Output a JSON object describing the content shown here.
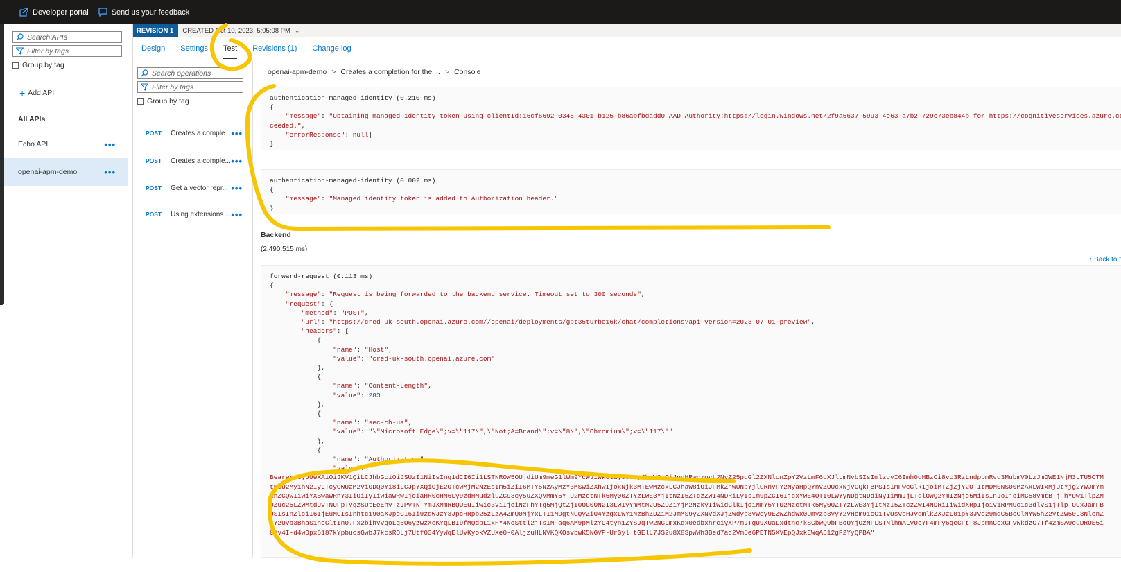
{
  "topbar": {
    "developer_portal": "Developer portal",
    "feedback": "Send us your feedback"
  },
  "api_pane": {
    "search_placeholder": "Search APIs",
    "filter_placeholder": "Filter by tags",
    "group_by_tag": "Group by tag",
    "add_api": "Add API",
    "all_apis": "All APIs",
    "apis": [
      {
        "name": "Echo API"
      },
      {
        "name": "openai-apm-demo"
      }
    ]
  },
  "revision": {
    "badge": "REVISION 1",
    "created": "CREATED Oct 10, 2023, 5:05:08 PM"
  },
  "tabs": [
    "Design",
    "Settings",
    "Test",
    "Revisions (1)",
    "Change log"
  ],
  "ops_pane": {
    "search_placeholder": "Search operations",
    "filter_placeholder": "Filter by tags",
    "group_by_tag": "Group by tag",
    "method": "POST",
    "operations": [
      "Creates a comple...",
      "Creates a comple...",
      "Get a vector repr...",
      "Using extensions ..."
    ]
  },
  "breadcrumb": [
    "openai-apm-demo",
    "Creates a completion for the ...",
    "Console"
  ],
  "console": {
    "trace1_header": "authentication-managed-identity (0.210 ms)",
    "trace1_message_line1": "Obtaining managed identity token using clientId:16cf6692-0345-4301-b125-b86abfbdadd0 AAD Authority:https://login.windows.net/2f9a5637-5993-4e63-a7b2-729e73eb844b for https://cognitiveservices.azure.com audience suc",
    "trace1_message_line2": "ceeded.",
    "trace1_error": "null",
    "trace2_header": "authentication-managed-identity (0.002 ms)",
    "trace2_message": "Managed identity token is added to Authorization header.",
    "backend_label": "Backend",
    "backend_time": "(2,490.515 ms)",
    "back_to_top": "↑ Back to t",
    "forward_header": "forward-request (0.113 ms)",
    "forward_message": "Request is being forwarded to the backend service. Timeout set to 300 seconds",
    "method": "POST",
    "url": "https://cred-uk-south.openai.azure.com//openai/deployments/gpt35turbo16k/chat/completions?api-version=2023-07-01-preview",
    "headers": [
      {
        "name": "Host",
        "value": "cred-uk-south.openai.azure.com"
      },
      {
        "name": "Content-Length",
        "value": "283"
      },
      {
        "name": "sec-ch-ua",
        "value": "\\\"Microsoft Edge\\\";v=\\\"117\\\",\\\"Not;A=Brand\\\";v=\\\"8\\\",\\\"Chromium\\\";v=\\\"117\\\""
      },
      {
        "name": "Authorization"
      }
    ],
    "auth_value_lines": [
      "Bearer eyJ0eXAiOiJKV1QiLCJhbGciOiJSUzI1NiIsIng1dCI6Ii1LSTNROW5OUjdiUm9meG1lWm9YcWJIWkdldyJ9.eyJhdWQiOiJodHRwczovL2NvZ25pdGl2ZXNlcnZpY2VzLmF6dXJlLmNvbSIsImlzcyI6Imh0dHBzOi8vc3RzLndpbmRvd3MubmV0LzJmOWE1NjM3LTU5OTMtNGU2My1hN2IyLTcyOWUzM2ViODQ0Yi8iLCJpYXQiOjE2OTcwMjM2NzEsIm5iZiI6MTY5NzAyMzY3MSwiZXhwIjoxNjk3MTEwMzcxLCJhaW8iOiJFMkZnWUNpYjlGRnVFY2NyaHpQYnVZOUcxNjVOQkFBPSIsImFwcGlkIjoiMTZjZjY2OTItMDM0NS00MzAxLWIxMjUtYjg2YWJmYmRhZGQwIiwiYXBwaWRhY3IiOiIyIiwiaWRwIjoiaHR0cHM6Ly9zdHMud2luZG93cy5uZXQvMmY5YTU2MzctNTk5My00ZTYzLWE3YjItNzI5ZTczZWI4NDRiLyIsIm9pZCI6IjcxYWE4OTI0LWYyNDgtNDdiNy1iMmJjLTdlOWQ2YmIzNjc5MiIsInJoIjoiMC58VmtBTjFhYUw1TlpZMDZuc25LZWMtdUVTNUFpTVgzSUtEeEhvTzJPVTNTYmJXMmRBQUEuIiwic3ViIjoiNzFhYTg5MjQtZjI0OC00N2I3LWIyYmMtN2U5ZDZiYjM2NzkyIiwidGlkIjoiMmY5YTU2MzctNTk5My00ZTYzLWE3YjItNzI5ZTczZWI4NDRiIiwidXRpIjoiV1RPMUc1c3dlVS1jTlpTOUxJamFBUSIsInZlciI6IjEuMCIsInhtc190aXJpcCI6Ii9zdWJzY3JpcHRpb25zLzA4ZmU0MjYxLTI1MDgtNGQyZi04YzgxLWY1NzBhZDZiM2JmMS9yZXNvdXJjZWdyb3Vwcy9EZWZhdWx0UmVzb3VyY2VHcm91cC1TVUsvcHJvdmlkZXJzL01pY3Jvc29mdC5BcGlNYW5hZ2VtZW50L3NlcnZpY2Uvb3BhaS1hcGltIn0.Fx2bihVvqoLg6O6yzwzXcKYqLBI9fMQdpL1xHY4NoSttl2jTsIN-aq6AM9pMlzYC4tyn1ZYSJqTw2NGLmxKdx0edbxhrciyXP7mJTgU9XUaLxdtnc7kSGbWQ9bFBoQYjOzNFLSTNlhmALv0oYF4mFy6qcCFt-8JbmnCexGFvWkdzC7Tf42mSA9cuDROE5i0jv4I-d4wDpx6187kYpbucsGwbJ7kcsROLj7Utf034YyWqElUvKyokVZUXe0-0AljzuHLNVKQKOsvbwK5NGVP-UrGyl_tGElL7JS2u8X8SpWWh3Bed7ac2Vm5e6PETN5XVEpQJxkEWqA612gF2YyQPBA"
    ]
  },
  "colors": {
    "accent": "#0078d4",
    "annotation": "#f7c600",
    "revision_badge": "#0f5c99"
  }
}
